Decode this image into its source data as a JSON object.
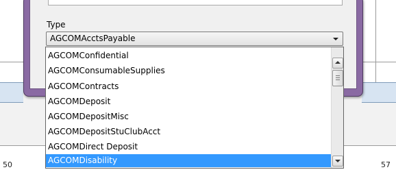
{
  "field": {
    "label": "Type",
    "selected_value": "AGCOMAcctsPayable"
  },
  "dropdown": {
    "items": [
      "AGCOMConfidential",
      "AGCOMConsumableSupplies",
      "AGCOMContracts",
      "AGCOMDeposit",
      "AGCOMDepositMisc",
      "AGCOMDepositStuClubAcct",
      "AGCOMDirect Deposit",
      "AGCOMDisability"
    ],
    "highlighted_item": "AGCOMDisability"
  },
  "background": {
    "ruler_left_number": "50",
    "ruler_right_number": "57"
  },
  "colors": {
    "dialog_frame": "#8a6aa3",
    "selection": "#3399ff"
  },
  "icons": {
    "combo_arrow": "chevron-down-icon",
    "scroll_up": "arrow-up-icon",
    "scroll_down": "arrow-down-icon"
  }
}
